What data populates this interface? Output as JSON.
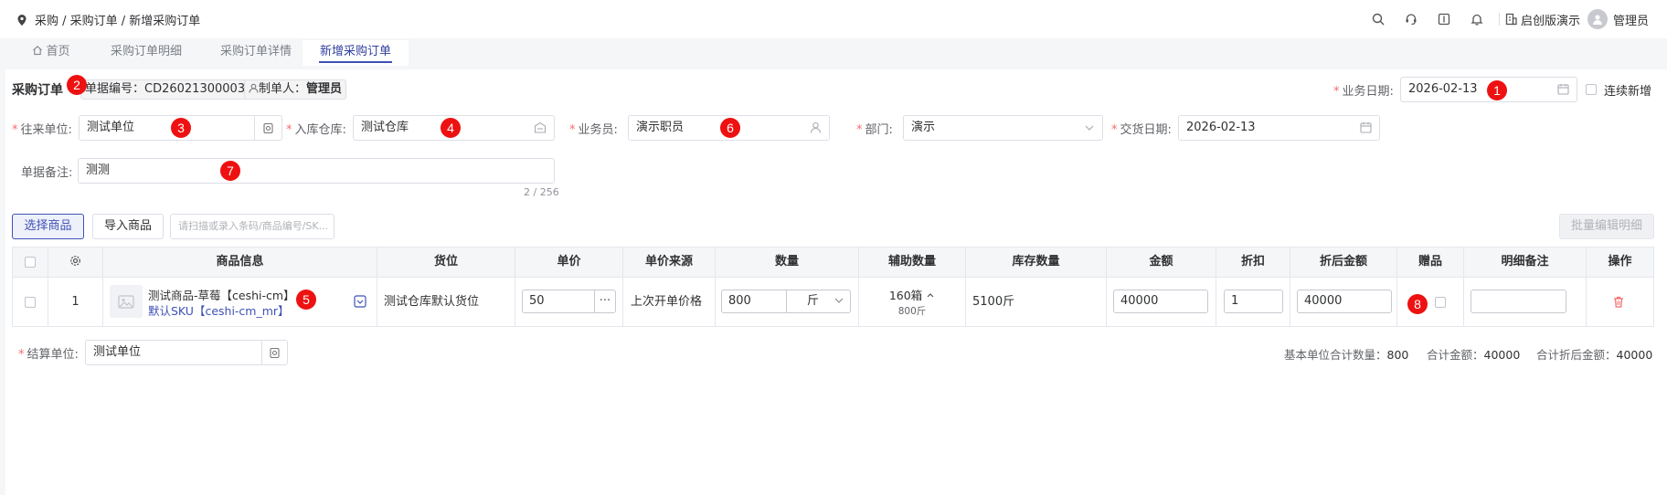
{
  "header": {
    "breadcrumb": "采购 / 采购订单 / 新增采购订单",
    "company": "启创版演示",
    "user": "管理员"
  },
  "tabs": [
    {
      "label": "首页"
    },
    {
      "label": "采购订单明细"
    },
    {
      "label": "采购订单详情"
    },
    {
      "label": "新增采购订单"
    }
  ],
  "form": {
    "title": "采购订单",
    "doc_no_label": "单据编号：",
    "doc_no": "CD26021300003",
    "creator_label": "制单人：",
    "creator": "管理员",
    "biz_date_label": "业务日期:",
    "biz_date": "2026-02-13",
    "continuous_label": "连续新增",
    "partner_label": "往来单位:",
    "partner": "测试单位",
    "warehouse_label": "入库仓库:",
    "warehouse": "测试仓库",
    "salesman_label": "业务员:",
    "salesman": "演示职员",
    "dept_label": "部门:",
    "dept": "演示",
    "delivery_label": "交货日期:",
    "delivery_date": "2026-02-13",
    "remark_label": "单据备注:",
    "remark": "测测",
    "remark_count": "2 / 256"
  },
  "toolbar": {
    "select_goods": "选择商品",
    "import_goods": "导入商品",
    "scan_placeholder": "请扫描或录入条码/商品编号/SK...",
    "batch_edit": "批量编辑明细"
  },
  "table": {
    "columns": [
      "商品信息",
      "货位",
      "单价",
      "单价来源",
      "数量",
      "辅助数量",
      "库存数量",
      "金额",
      "折扣",
      "折后金额",
      "赠品",
      "明细备注",
      "操作"
    ],
    "rows": [
      {
        "index": "1",
        "product_name": "测试商品-草莓【ceshi-cm】",
        "product_sku": "默认SKU【ceshi-cm_mr】",
        "location": "测试仓库默认货位",
        "price": "50",
        "price_source": "上次开单价格",
        "qty": "800",
        "unit": "斤",
        "aux_qty": "160箱",
        "aux_sub": "800斤",
        "stock": "5100斤",
        "amount": "40000",
        "discount": "1",
        "net_amount": "40000",
        "line_remark": ""
      }
    ]
  },
  "settlement": {
    "label": "结算单位:",
    "value": "测试单位"
  },
  "summary": {
    "base_qty_label": "基本单位合计数量：",
    "base_qty": "800",
    "total_label": "合计金额：",
    "total": "40000",
    "net_total_label": "合计折后金额：",
    "net_total": "40000"
  },
  "markers": [
    "1",
    "2",
    "3",
    "4",
    "5",
    "6",
    "7",
    "8"
  ],
  "colors": {
    "accent": "#3f51b5",
    "required": "#f56c6c",
    "marker": "#ee1111",
    "delete": "#f56c6c"
  }
}
